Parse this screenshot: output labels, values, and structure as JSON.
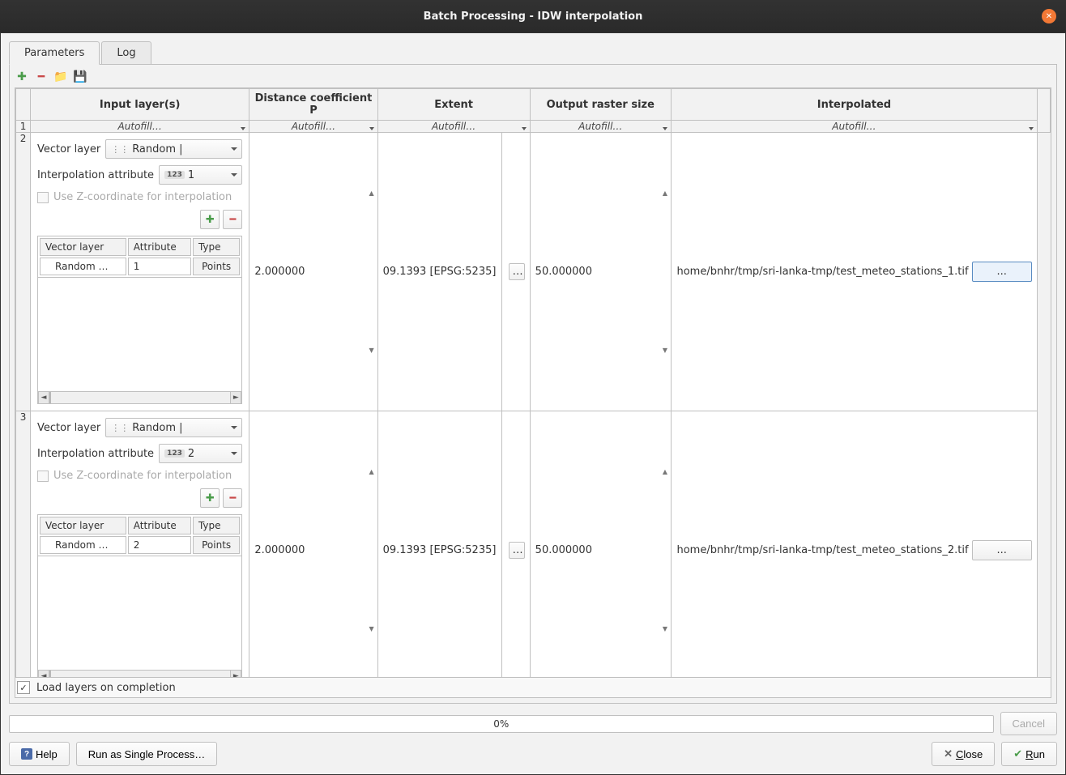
{
  "window": {
    "title": "Batch Processing - IDW interpolation"
  },
  "tabs": {
    "parameters": "Parameters",
    "log": "Log"
  },
  "columns": {
    "input": "Input layer(s)",
    "distance": "Distance coefficient P",
    "extent": "Extent",
    "raster": "Output raster size",
    "interp": "Interpolated"
  },
  "autofill": "Autofill…",
  "labels": {
    "vector_layer": "Vector layer",
    "interp_attr": "Interpolation attribute",
    "use_z": "Use Z-coordinate for interpolation",
    "col_vector": "Vector layer",
    "col_attr": "Attribute",
    "col_type": "Type"
  },
  "rows": [
    {
      "num": "2",
      "vector_combo": "Random |",
      "attr_combo": "1",
      "sub_vector": "Random …",
      "sub_attr": "1",
      "sub_type": "Points",
      "distance": "2.000000",
      "extent": "09.1393 [EPSG:5235]",
      "raster": "50.000000",
      "output": "home/bnhr/tmp/sri-lanka-tmp/test_meteo_stations_1.tif",
      "browse_selected": true
    },
    {
      "num": "3",
      "vector_combo": "Random |",
      "attr_combo": "2",
      "sub_vector": "Random …",
      "sub_attr": "2",
      "sub_type": "Points",
      "distance": "2.000000",
      "extent": "09.1393 [EPSG:5235]",
      "raster": "50.000000",
      "output": "home/bnhr/tmp/sri-lanka-tmp/test_meteo_stations_2.tif",
      "browse_selected": false
    }
  ],
  "row1": "1",
  "footer": {
    "load_layers": "Load layers on completion"
  },
  "progress": "0%",
  "buttons": {
    "cancel": "Cancel",
    "help": "Help",
    "single": "Run as Single Process…",
    "close": "Close",
    "run": "Run",
    "browse": "...",
    "extent_btn": "…"
  }
}
